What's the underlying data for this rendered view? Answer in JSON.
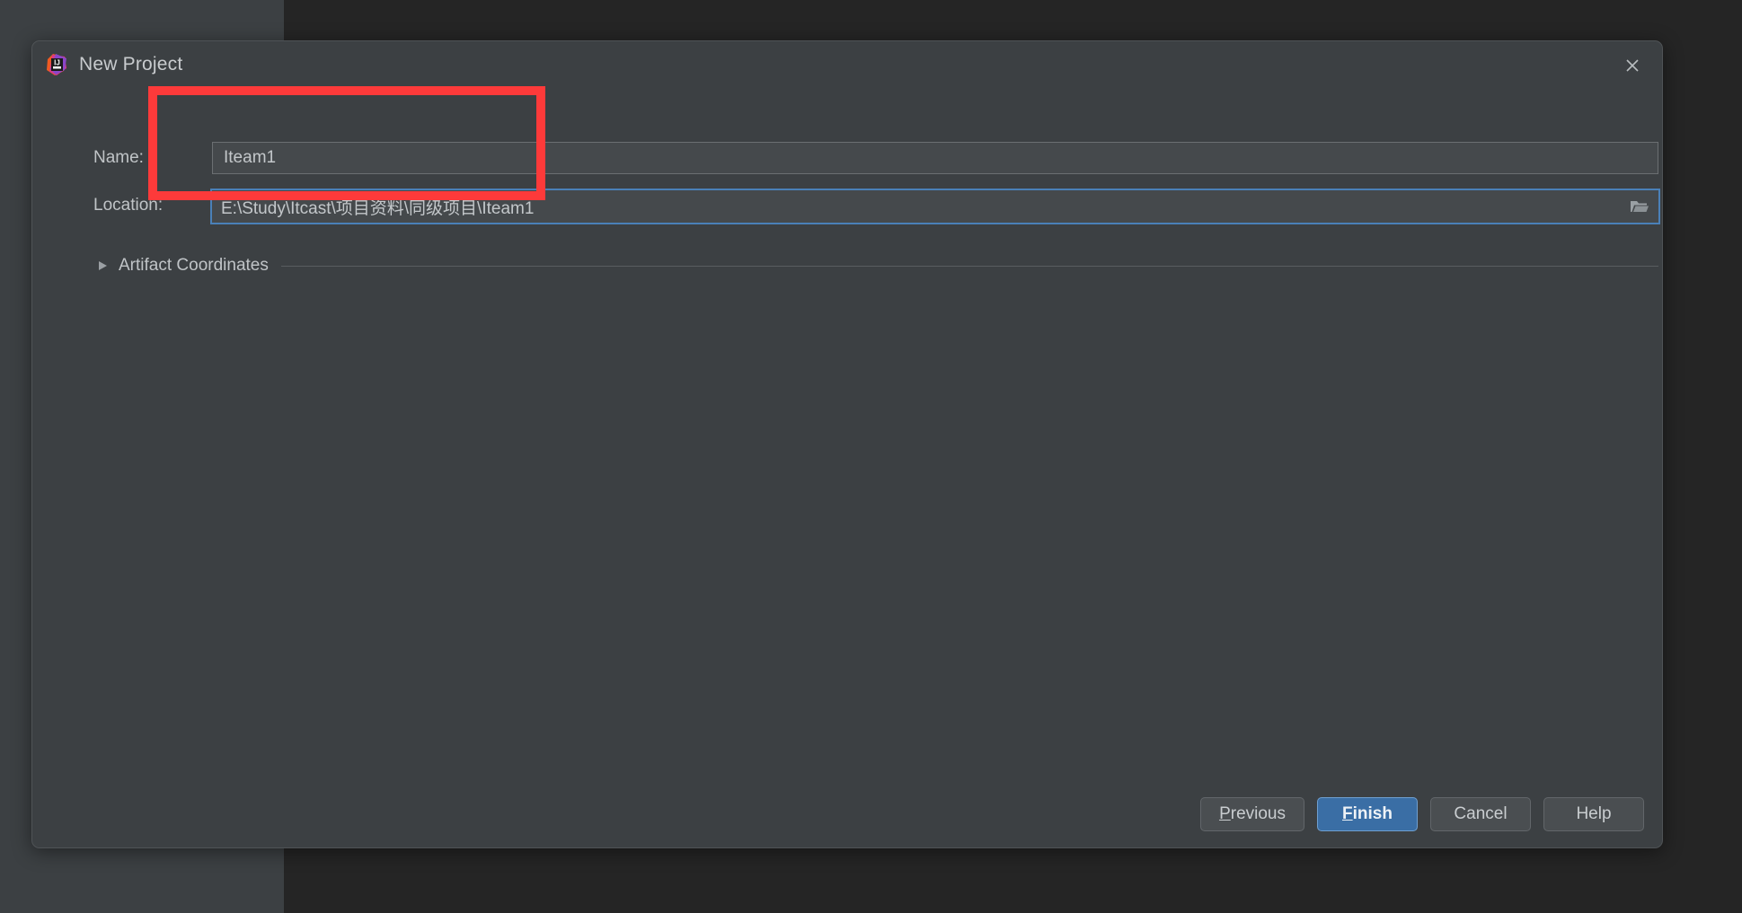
{
  "window": {
    "title": "New Project",
    "app_icon": "intellij-idea-icon",
    "close_icon": "close-icon"
  },
  "form": {
    "name": {
      "label": "Name:",
      "value": "Iteam1",
      "placeholder": ""
    },
    "location": {
      "label": "Location:",
      "value": "E:\\Study\\Itcast\\项目资料\\同级项目\\Iteam1",
      "placeholder": "",
      "browse_icon": "folder-open-icon",
      "focused": true
    }
  },
  "sections": {
    "artifact_coordinates": {
      "label": "Artifact Coordinates",
      "expanded": false,
      "chevron_icon": "triangle-right-icon"
    }
  },
  "footer": {
    "previous": "Previous",
    "previous_mnemonic": "P",
    "finish": "Finish",
    "finish_mnemonic": "F",
    "cancel": "Cancel",
    "help": "Help"
  },
  "colors": {
    "dialog_background": "#3c4043",
    "desktop_dark": "#252525",
    "desktop_panel": "#3c4043",
    "field_background": "#45494c",
    "focus_border": "#4a80b8",
    "primary_button": "#3a6ea5",
    "annotation_red": "#fd3a3a",
    "text": "#c0c4c7"
  }
}
